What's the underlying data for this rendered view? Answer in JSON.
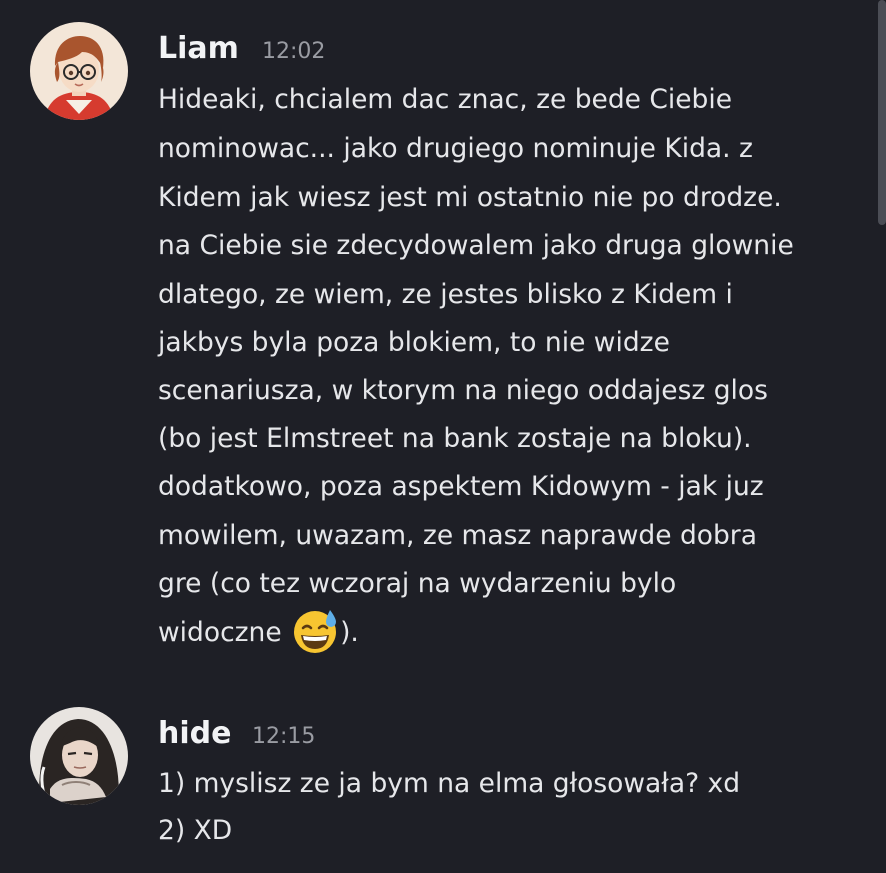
{
  "messages": [
    {
      "author": "Liam",
      "time": "12:02",
      "avatar_icon": "anime-boy-glasses-avatar",
      "lines": [
        "Hideaki, chcialem dac znac, ze bede Ciebie",
        "nominowac... jako drugiego nominuje Kida. z",
        "Kidem jak wiesz jest mi ostatnio nie po drodze.",
        "na Ciebie sie zdecydowalem jako druga glownie",
        "dlatego, ze wiem, ze jestes blisko z Kidem i",
        "jakbys byla poza blokiem, to nie widze",
        "scenariusza, w ktorym na niego oddajesz glos",
        "(bo jest Elmstreet na bank zostaje na bloku).",
        "dodatkowo, poza aspektem Kidowym - jak juz",
        "mowilem, uwazam, ze masz naprawde dobra",
        "gre (co tez wczoraj na wydarzeniu bylo"
      ],
      "last_line_before_emoji": "widoczne ",
      "emoji_icon": "grinning-face-with-sweat-emoji",
      "last_line_after_emoji": ")."
    },
    {
      "author": "hide",
      "time": "12:15",
      "avatar_icon": "long-hair-character-avatar",
      "lines": [
        "1) myslisz ze ja bym na elma głosowała? xd",
        "2) XD"
      ]
    }
  ],
  "colors": {
    "background": "#1e1f26",
    "username": "#f2f3f5",
    "timestamp": "#9a9ca3",
    "text": "#e6e7ea"
  }
}
